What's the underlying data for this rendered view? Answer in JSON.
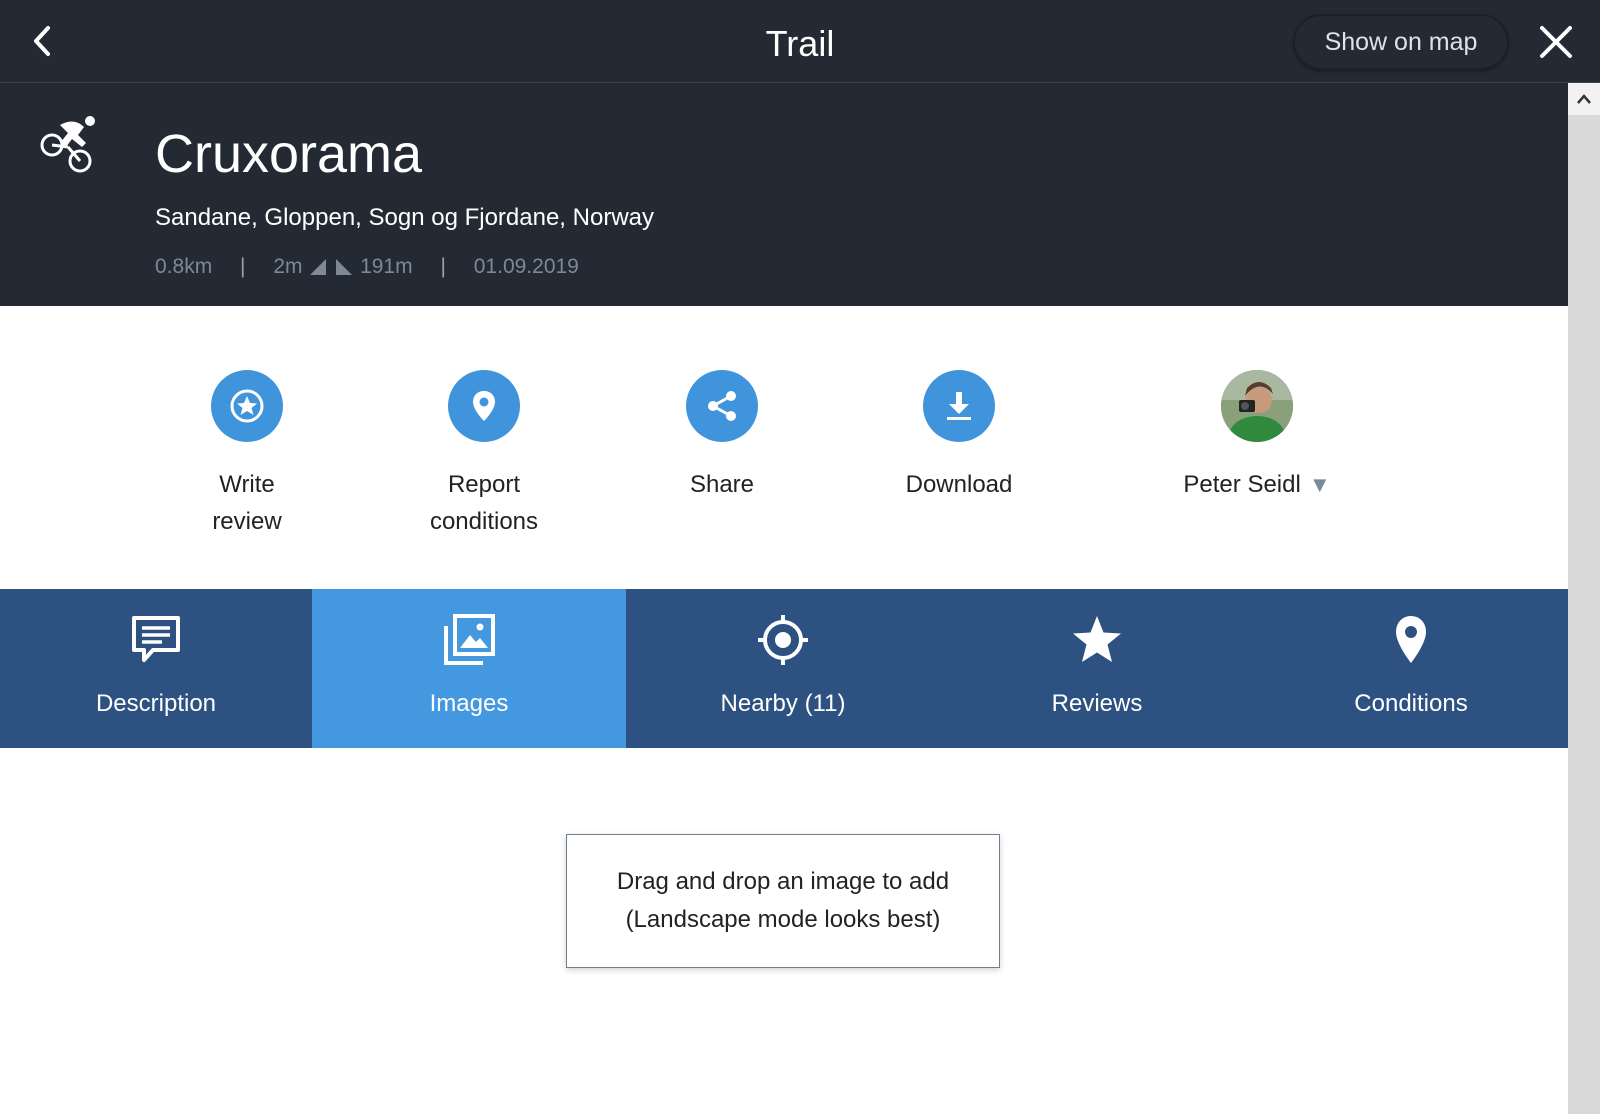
{
  "topbar": {
    "title": "Trail",
    "show_map_label": "Show on map"
  },
  "trail": {
    "name": "Cruxorama",
    "location": "Sandane, Gloppen, Sogn og Fjordane, Norway",
    "distance": "0.8km",
    "climb": "2m",
    "descent": "191m",
    "date": "01.09.2019",
    "activity_icon": "mountain-bike-icon"
  },
  "actions": [
    {
      "label_line1": "Write",
      "label_line2": "review",
      "icon": "star-badge-icon"
    },
    {
      "label_line1": "Report",
      "label_line2": "conditions",
      "icon": "location-pin-icon"
    },
    {
      "label_line1": "Share",
      "label_line2": "",
      "icon": "share-icon"
    },
    {
      "label_line1": "Download",
      "label_line2": "",
      "icon": "download-icon"
    }
  ],
  "user": {
    "name": "Peter Seidl",
    "caret": "▼"
  },
  "tabs": [
    {
      "label": "Description",
      "icon": "comment-icon",
      "active": false
    },
    {
      "label": "Images",
      "icon": "images-icon",
      "active": true
    },
    {
      "label": "Nearby (11)",
      "icon": "crosshair-icon",
      "active": false
    },
    {
      "label": "Reviews",
      "icon": "star-icon",
      "active": false
    },
    {
      "label": "Conditions",
      "icon": "location-pin-icon",
      "active": false
    }
  ],
  "dropzone": {
    "line1": "Drag and drop an image to add",
    "line2": "(Landscape mode looks best)"
  },
  "colors": {
    "header_bg": "#232a33",
    "action_blue": "#3f94dc",
    "tab_bg": "#2d5281",
    "tab_active": "#4398df"
  }
}
